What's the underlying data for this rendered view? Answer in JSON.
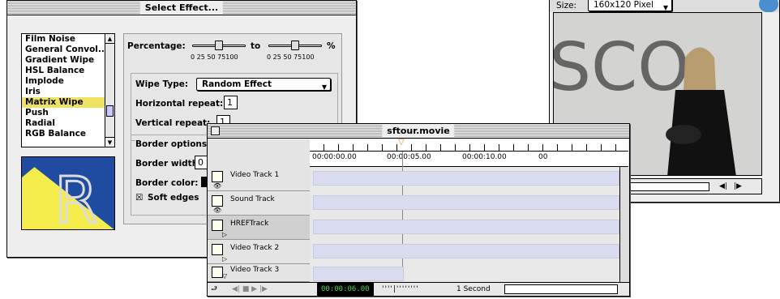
{
  "effect_window": {
    "title": "Select Effect...",
    "effects": [
      "Film Noise",
      "General Convol...",
      "Gradient Wipe",
      "HSL Balance",
      "Implode",
      "Iris",
      "Matrix Wipe",
      "Push",
      "Radial",
      "RGB Balance"
    ],
    "selected_effect": "Matrix Wipe",
    "percentage_label": "Percentage:",
    "to_label": "to",
    "percent_sign": "%",
    "slider_ticks": "0  25 50 75100",
    "wipe_type_label": "Wipe Type:",
    "wipe_type_value": "Random Effect",
    "horizontal_repeat_label": "Horizontal repeat:",
    "horizontal_repeat_value": "1",
    "vertical_repeat_label": "Vertical repeat:",
    "vertical_repeat_value": "1",
    "border_options_label": "Border options:",
    "border_width_label": "Border width:",
    "border_width_value": "0",
    "border_color_label": "Border color:",
    "soft_edges_label": "Soft edges",
    "soft_edges_checked": "☒",
    "logo_letter": "R"
  },
  "movie_window": {
    "size_label": "Size:",
    "size_value": "160x120 Pixel",
    "video_text": "SCO",
    "speaker_icon": "speaker-icon",
    "play_icon": "play-icon"
  },
  "tour_window": {
    "title": "sftour.movie",
    "ruler_times": [
      "00:00:00.00",
      "00:00:05.00",
      "00:00:10.00",
      "00"
    ],
    "tracks": [
      {
        "name": "Video Track 1",
        "sub": "👁"
      },
      {
        "name": "Sound Track",
        "sub": "👁"
      },
      {
        "name": "HREFTrack",
        "sub": "▷"
      },
      {
        "name": "Video Track 2",
        "sub": "▷"
      },
      {
        "name": "Video Track 3",
        "sub": "▽"
      }
    ],
    "current_time": "00:00:06.00",
    "zoom_label": "1 Second"
  },
  "colors": {
    "selection": "#ede262",
    "lane": "#d9dbf0",
    "timecode": "#4fd14f"
  }
}
